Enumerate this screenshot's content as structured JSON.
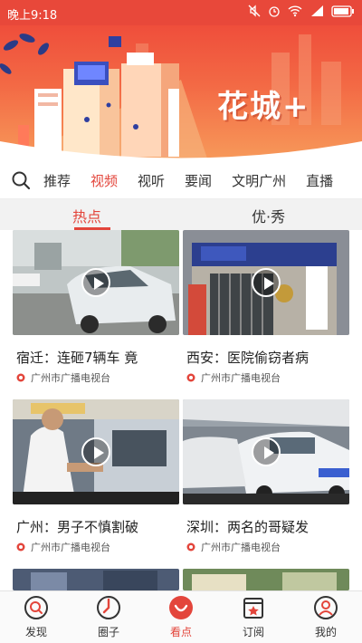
{
  "status_bar": {
    "time": "晚上9:18"
  },
  "hero": {
    "title": "花城+"
  },
  "channels": {
    "items": [
      "推荐",
      "视频",
      "视听",
      "要闻",
      "文明广州",
      "直播"
    ],
    "active": "视频"
  },
  "sub_tabs": {
    "items": [
      "热点",
      "优·秀"
    ],
    "active": "热点"
  },
  "videos": [
    {
      "title": "宿迁：连砸7辆车 竟",
      "source": "广州市广播电视台"
    },
    {
      "title": "西安：医院偷窃者病",
      "source": "广州市广播电视台"
    },
    {
      "title": "广州：男子不慎割破",
      "source": "广州市广播电视台"
    },
    {
      "title": "深圳：两名的哥疑发",
      "source": "广州市广播电视台"
    }
  ],
  "bottom_nav": {
    "items": [
      "发现",
      "圈子",
      "看点",
      "订阅",
      "我的"
    ],
    "active": "看点"
  },
  "colors": {
    "accent": "#e3453b",
    "status_bar": "#e8483a"
  }
}
